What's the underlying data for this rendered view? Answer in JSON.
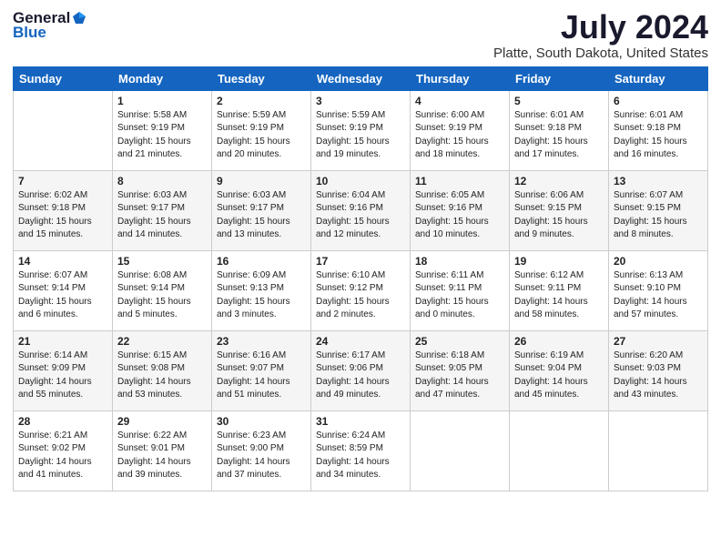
{
  "header": {
    "logo_general": "General",
    "logo_blue": "Blue",
    "title": "July 2024",
    "location": "Platte, South Dakota, United States"
  },
  "calendar": {
    "days_of_week": [
      "Sunday",
      "Monday",
      "Tuesday",
      "Wednesday",
      "Thursday",
      "Friday",
      "Saturday"
    ],
    "weeks": [
      [
        {
          "day": "",
          "info": ""
        },
        {
          "day": "1",
          "info": "Sunrise: 5:58 AM\nSunset: 9:19 PM\nDaylight: 15 hours\nand 21 minutes."
        },
        {
          "day": "2",
          "info": "Sunrise: 5:59 AM\nSunset: 9:19 PM\nDaylight: 15 hours\nand 20 minutes."
        },
        {
          "day": "3",
          "info": "Sunrise: 5:59 AM\nSunset: 9:19 PM\nDaylight: 15 hours\nand 19 minutes."
        },
        {
          "day": "4",
          "info": "Sunrise: 6:00 AM\nSunset: 9:19 PM\nDaylight: 15 hours\nand 18 minutes."
        },
        {
          "day": "5",
          "info": "Sunrise: 6:01 AM\nSunset: 9:18 PM\nDaylight: 15 hours\nand 17 minutes."
        },
        {
          "day": "6",
          "info": "Sunrise: 6:01 AM\nSunset: 9:18 PM\nDaylight: 15 hours\nand 16 minutes."
        }
      ],
      [
        {
          "day": "7",
          "info": "Sunrise: 6:02 AM\nSunset: 9:18 PM\nDaylight: 15 hours\nand 15 minutes."
        },
        {
          "day": "8",
          "info": "Sunrise: 6:03 AM\nSunset: 9:17 PM\nDaylight: 15 hours\nand 14 minutes."
        },
        {
          "day": "9",
          "info": "Sunrise: 6:03 AM\nSunset: 9:17 PM\nDaylight: 15 hours\nand 13 minutes."
        },
        {
          "day": "10",
          "info": "Sunrise: 6:04 AM\nSunset: 9:16 PM\nDaylight: 15 hours\nand 12 minutes."
        },
        {
          "day": "11",
          "info": "Sunrise: 6:05 AM\nSunset: 9:16 PM\nDaylight: 15 hours\nand 10 minutes."
        },
        {
          "day": "12",
          "info": "Sunrise: 6:06 AM\nSunset: 9:15 PM\nDaylight: 15 hours\nand 9 minutes."
        },
        {
          "day": "13",
          "info": "Sunrise: 6:07 AM\nSunset: 9:15 PM\nDaylight: 15 hours\nand 8 minutes."
        }
      ],
      [
        {
          "day": "14",
          "info": "Sunrise: 6:07 AM\nSunset: 9:14 PM\nDaylight: 15 hours\nand 6 minutes."
        },
        {
          "day": "15",
          "info": "Sunrise: 6:08 AM\nSunset: 9:14 PM\nDaylight: 15 hours\nand 5 minutes."
        },
        {
          "day": "16",
          "info": "Sunrise: 6:09 AM\nSunset: 9:13 PM\nDaylight: 15 hours\nand 3 minutes."
        },
        {
          "day": "17",
          "info": "Sunrise: 6:10 AM\nSunset: 9:12 PM\nDaylight: 15 hours\nand 2 minutes."
        },
        {
          "day": "18",
          "info": "Sunrise: 6:11 AM\nSunset: 9:11 PM\nDaylight: 15 hours\nand 0 minutes."
        },
        {
          "day": "19",
          "info": "Sunrise: 6:12 AM\nSunset: 9:11 PM\nDaylight: 14 hours\nand 58 minutes."
        },
        {
          "day": "20",
          "info": "Sunrise: 6:13 AM\nSunset: 9:10 PM\nDaylight: 14 hours\nand 57 minutes."
        }
      ],
      [
        {
          "day": "21",
          "info": "Sunrise: 6:14 AM\nSunset: 9:09 PM\nDaylight: 14 hours\nand 55 minutes."
        },
        {
          "day": "22",
          "info": "Sunrise: 6:15 AM\nSunset: 9:08 PM\nDaylight: 14 hours\nand 53 minutes."
        },
        {
          "day": "23",
          "info": "Sunrise: 6:16 AM\nSunset: 9:07 PM\nDaylight: 14 hours\nand 51 minutes."
        },
        {
          "day": "24",
          "info": "Sunrise: 6:17 AM\nSunset: 9:06 PM\nDaylight: 14 hours\nand 49 minutes."
        },
        {
          "day": "25",
          "info": "Sunrise: 6:18 AM\nSunset: 9:05 PM\nDaylight: 14 hours\nand 47 minutes."
        },
        {
          "day": "26",
          "info": "Sunrise: 6:19 AM\nSunset: 9:04 PM\nDaylight: 14 hours\nand 45 minutes."
        },
        {
          "day": "27",
          "info": "Sunrise: 6:20 AM\nSunset: 9:03 PM\nDaylight: 14 hours\nand 43 minutes."
        }
      ],
      [
        {
          "day": "28",
          "info": "Sunrise: 6:21 AM\nSunset: 9:02 PM\nDaylight: 14 hours\nand 41 minutes."
        },
        {
          "day": "29",
          "info": "Sunrise: 6:22 AM\nSunset: 9:01 PM\nDaylight: 14 hours\nand 39 minutes."
        },
        {
          "day": "30",
          "info": "Sunrise: 6:23 AM\nSunset: 9:00 PM\nDaylight: 14 hours\nand 37 minutes."
        },
        {
          "day": "31",
          "info": "Sunrise: 6:24 AM\nSunset: 8:59 PM\nDaylight: 14 hours\nand 34 minutes."
        },
        {
          "day": "",
          "info": ""
        },
        {
          "day": "",
          "info": ""
        },
        {
          "day": "",
          "info": ""
        }
      ]
    ]
  }
}
